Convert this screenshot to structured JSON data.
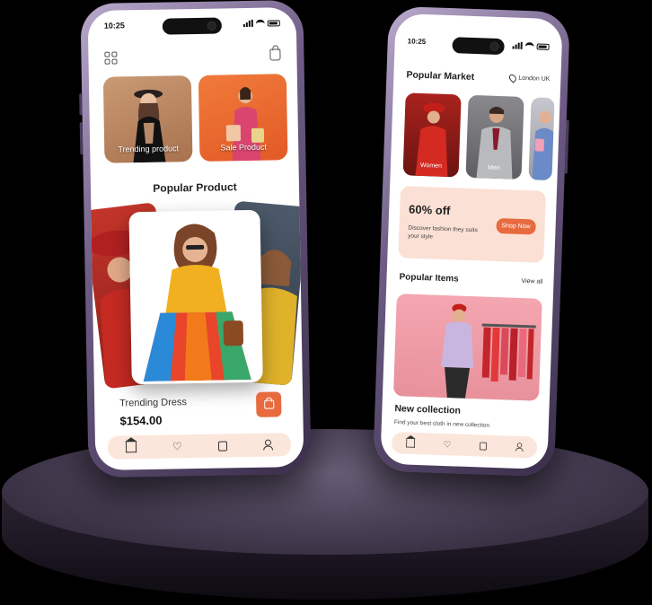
{
  "left_phone": {
    "status_time": "10:25",
    "categories": [
      {
        "label": "Trending product"
      },
      {
        "label": "Sale Product"
      }
    ],
    "section_title": "Popular Product",
    "product": {
      "name": "Trending Dress",
      "price": "$154.00"
    },
    "nav": [
      "home-icon",
      "heart-icon",
      "bag-icon",
      "user-icon"
    ]
  },
  "right_phone": {
    "status_time": "10:25",
    "title": "Popular Market",
    "location": "London UK",
    "categories": [
      {
        "label": "Women"
      },
      {
        "label": "Men"
      },
      {
        "label": ""
      }
    ],
    "promo": {
      "percent": "60% off",
      "description": "Discover fashion they suits your style",
      "button": "Shop Now"
    },
    "section": {
      "title": "Popular Items",
      "view_all": "View all"
    },
    "collection": {
      "title": "New collection",
      "subtitle": "Find your best cloth in new collection"
    },
    "nav": [
      "home-icon",
      "heart-icon",
      "bag-icon",
      "user-icon"
    ]
  },
  "colors": {
    "accent": "#e86a3f",
    "promo_bg": "#fbe0d5",
    "nav_bg": "#fbe6db",
    "phone_frame": "#7a6794",
    "pedestal": "#4b4157"
  }
}
